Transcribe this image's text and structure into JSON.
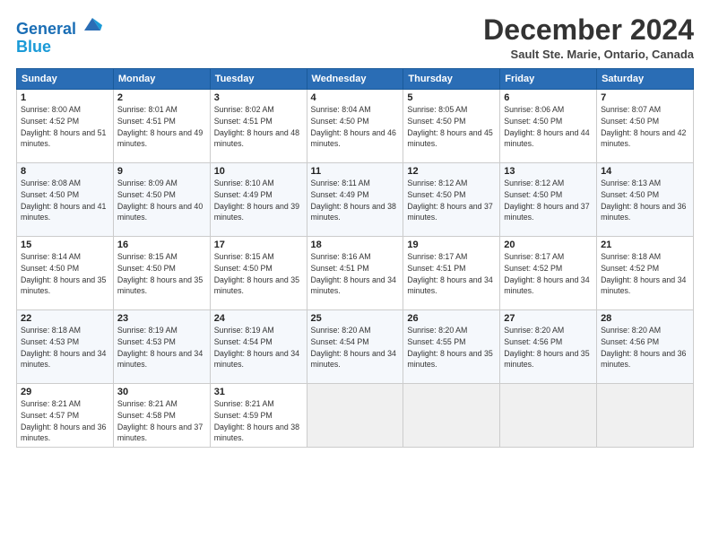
{
  "logo": {
    "line1": "General",
    "line2": "Blue"
  },
  "title": "December 2024",
  "location": "Sault Ste. Marie, Ontario, Canada",
  "weekdays": [
    "Sunday",
    "Monday",
    "Tuesday",
    "Wednesday",
    "Thursday",
    "Friday",
    "Saturday"
  ],
  "weeks": [
    [
      {
        "day": "1",
        "rise": "8:00 AM",
        "set": "4:52 PM",
        "daylight": "8 hours and 51 minutes."
      },
      {
        "day": "2",
        "rise": "8:01 AM",
        "set": "4:51 PM",
        "daylight": "8 hours and 49 minutes."
      },
      {
        "day": "3",
        "rise": "8:02 AM",
        "set": "4:51 PM",
        "daylight": "8 hours and 48 minutes."
      },
      {
        "day": "4",
        "rise": "8:04 AM",
        "set": "4:50 PM",
        "daylight": "8 hours and 46 minutes."
      },
      {
        "day": "5",
        "rise": "8:05 AM",
        "set": "4:50 PM",
        "daylight": "8 hours and 45 minutes."
      },
      {
        "day": "6",
        "rise": "8:06 AM",
        "set": "4:50 PM",
        "daylight": "8 hours and 44 minutes."
      },
      {
        "day": "7",
        "rise": "8:07 AM",
        "set": "4:50 PM",
        "daylight": "8 hours and 42 minutes."
      }
    ],
    [
      {
        "day": "8",
        "rise": "8:08 AM",
        "set": "4:50 PM",
        "daylight": "8 hours and 41 minutes."
      },
      {
        "day": "9",
        "rise": "8:09 AM",
        "set": "4:50 PM",
        "daylight": "8 hours and 40 minutes."
      },
      {
        "day": "10",
        "rise": "8:10 AM",
        "set": "4:49 PM",
        "daylight": "8 hours and 39 minutes."
      },
      {
        "day": "11",
        "rise": "8:11 AM",
        "set": "4:49 PM",
        "daylight": "8 hours and 38 minutes."
      },
      {
        "day": "12",
        "rise": "8:12 AM",
        "set": "4:50 PM",
        "daylight": "8 hours and 37 minutes."
      },
      {
        "day": "13",
        "rise": "8:12 AM",
        "set": "4:50 PM",
        "daylight": "8 hours and 37 minutes."
      },
      {
        "day": "14",
        "rise": "8:13 AM",
        "set": "4:50 PM",
        "daylight": "8 hours and 36 minutes."
      }
    ],
    [
      {
        "day": "15",
        "rise": "8:14 AM",
        "set": "4:50 PM",
        "daylight": "8 hours and 35 minutes."
      },
      {
        "day": "16",
        "rise": "8:15 AM",
        "set": "4:50 PM",
        "daylight": "8 hours and 35 minutes."
      },
      {
        "day": "17",
        "rise": "8:15 AM",
        "set": "4:50 PM",
        "daylight": "8 hours and 35 minutes."
      },
      {
        "day": "18",
        "rise": "8:16 AM",
        "set": "4:51 PM",
        "daylight": "8 hours and 34 minutes."
      },
      {
        "day": "19",
        "rise": "8:17 AM",
        "set": "4:51 PM",
        "daylight": "8 hours and 34 minutes."
      },
      {
        "day": "20",
        "rise": "8:17 AM",
        "set": "4:52 PM",
        "daylight": "8 hours and 34 minutes."
      },
      {
        "day": "21",
        "rise": "8:18 AM",
        "set": "4:52 PM",
        "daylight": "8 hours and 34 minutes."
      }
    ],
    [
      {
        "day": "22",
        "rise": "8:18 AM",
        "set": "4:53 PM",
        "daylight": "8 hours and 34 minutes."
      },
      {
        "day": "23",
        "rise": "8:19 AM",
        "set": "4:53 PM",
        "daylight": "8 hours and 34 minutes."
      },
      {
        "day": "24",
        "rise": "8:19 AM",
        "set": "4:54 PM",
        "daylight": "8 hours and 34 minutes."
      },
      {
        "day": "25",
        "rise": "8:20 AM",
        "set": "4:54 PM",
        "daylight": "8 hours and 34 minutes."
      },
      {
        "day": "26",
        "rise": "8:20 AM",
        "set": "4:55 PM",
        "daylight": "8 hours and 35 minutes."
      },
      {
        "day": "27",
        "rise": "8:20 AM",
        "set": "4:56 PM",
        "daylight": "8 hours and 35 minutes."
      },
      {
        "day": "28",
        "rise": "8:20 AM",
        "set": "4:56 PM",
        "daylight": "8 hours and 36 minutes."
      }
    ],
    [
      {
        "day": "29",
        "rise": "8:21 AM",
        "set": "4:57 PM",
        "daylight": "8 hours and 36 minutes."
      },
      {
        "day": "30",
        "rise": "8:21 AM",
        "set": "4:58 PM",
        "daylight": "8 hours and 37 minutes."
      },
      {
        "day": "31",
        "rise": "8:21 AM",
        "set": "4:59 PM",
        "daylight": "8 hours and 38 minutes."
      },
      null,
      null,
      null,
      null
    ]
  ]
}
